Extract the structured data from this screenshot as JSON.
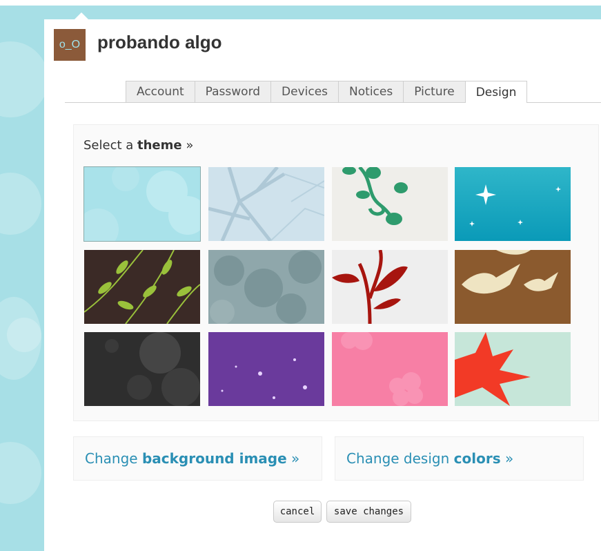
{
  "profile": {
    "avatar_text": "o_O",
    "name": "probando algo"
  },
  "tabs": [
    {
      "label": "Account",
      "active": false
    },
    {
      "label": "Password",
      "active": false
    },
    {
      "label": "Devices",
      "active": false
    },
    {
      "label": "Notices",
      "active": false
    },
    {
      "label": "Picture",
      "active": false
    },
    {
      "label": "Design",
      "active": true
    }
  ],
  "theme_section": {
    "heading_prefix": "Select a",
    "heading_bold": "theme",
    "heading_suffix": "»"
  },
  "themes": [
    {
      "name": "sky-clouds",
      "selected": true
    },
    {
      "name": "bare-branches"
    },
    {
      "name": "green-vine"
    },
    {
      "name": "turquoise-stars"
    },
    {
      "name": "brown-leaves"
    },
    {
      "name": "grey-foliage"
    },
    {
      "name": "red-plant"
    },
    {
      "name": "brown-birds"
    },
    {
      "name": "dark-foliage"
    },
    {
      "name": "purple-sparkles"
    },
    {
      "name": "pink-flowers"
    },
    {
      "name": "red-maple"
    }
  ],
  "options": {
    "background": {
      "prefix": "Change",
      "bold": "background image",
      "suffix": "»"
    },
    "colors": {
      "prefix": "Change design",
      "bold": "colors",
      "suffix": "»"
    }
  },
  "buttons": {
    "cancel": "cancel",
    "save": "save changes"
  },
  "colors": {
    "background": "#a7dfe6",
    "link": "#2a8fb4",
    "avatar_bg": "#8b5a3a"
  }
}
